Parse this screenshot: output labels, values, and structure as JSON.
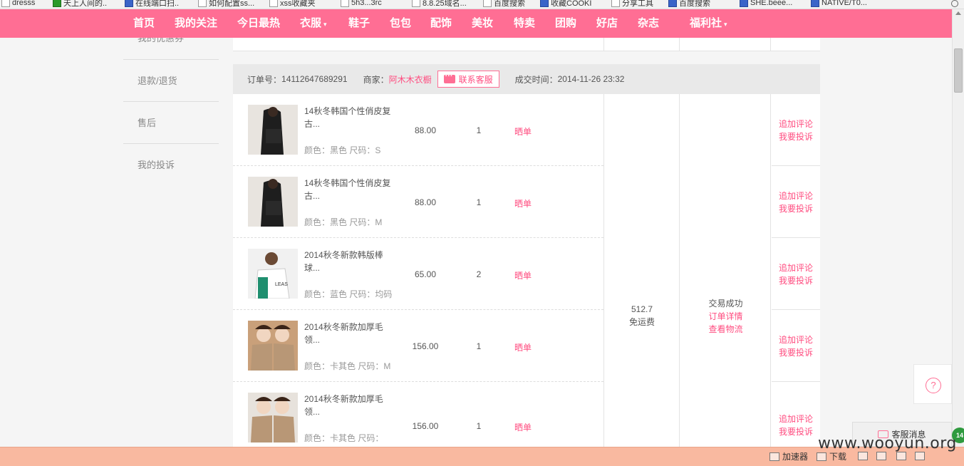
{
  "bookmarks": [
    {
      "label": "dresss",
      "icon": "page-icon"
    },
    {
      "label": "天上人间的..",
      "icon": "excel-icon"
    },
    {
      "label": "在线端口扫..",
      "icon": "tool-icon"
    },
    {
      "label": "如何配置ss...",
      "icon": "page-icon"
    },
    {
      "label": "xss收藏夹",
      "icon": "page-icon"
    },
    {
      "label": "5h3...3rc",
      "icon": "page-icon"
    },
    {
      "label": "8.8.25域名...",
      "icon": "page-icon"
    },
    {
      "label": "百度搜索",
      "icon": "page-icon"
    },
    {
      "label": "收藏COOKI",
      "icon": "globe-icon"
    },
    {
      "label": "分享工具",
      "icon": "page-icon"
    },
    {
      "label": "百度搜索",
      "icon": "page-icon"
    },
    {
      "label": "SHE.beee...",
      "icon": "page-icon"
    },
    {
      "label": "NATIVE/T0...",
      "icon": "page-icon"
    }
  ],
  "nav": {
    "items": [
      "首页",
      "我的关注",
      "今日最热",
      "衣服",
      "鞋子",
      "包包",
      "配饰",
      "美妆",
      "特卖",
      "团购",
      "好店",
      "杂志",
      "福利社"
    ],
    "dropdown_caret": "▾"
  },
  "sidebar": {
    "items": [
      "我的优惠券",
      "退款/退货",
      "售后",
      "我的投诉"
    ]
  },
  "order": {
    "number_label": "订单号：",
    "number": "14112647689291",
    "merchant_label": "商家：",
    "merchant": "阿木木衣橱",
    "contact_button": "联系客服",
    "time_label": "成交时间：",
    "time": "2014-11-26 23:32",
    "total": "512.7",
    "shipping": "免运费",
    "status": "交易成功",
    "detail_link": "订单详情",
    "logistics_link": "查看物流",
    "products": [
      {
        "name": "14秋冬韩国个性俏皮复古...",
        "attrs": "颜色：黑色 尺码：S",
        "price": "88.00",
        "qty": "1",
        "show": "晒单",
        "review": "追加评论",
        "complain": "我要投诉"
      },
      {
        "name": "14秋冬韩国个性俏皮复古...",
        "attrs": "颜色：黑色 尺码：M",
        "price": "88.00",
        "qty": "1",
        "show": "晒单",
        "review": "追加评论",
        "complain": "我要投诉"
      },
      {
        "name": "2014秋冬新款韩版棒球...",
        "attrs": "颜色：蓝色 尺码：均码",
        "price": "65.00",
        "qty": "2",
        "show": "晒单",
        "review": "追加评论",
        "complain": "我要投诉"
      },
      {
        "name": "2014秋冬新款加厚毛领...",
        "attrs": "颜色：卡其色 尺码：M",
        "price": "156.00",
        "qty": "1",
        "show": "晒单",
        "review": "追加评论",
        "complain": "我要投诉"
      },
      {
        "name": "2014秋冬新款加厚毛领...",
        "attrs": "颜色：卡其色 尺码：",
        "price": "156.00",
        "qty": "1",
        "show": "晒单",
        "review": "追加评论",
        "complain": "我要投诉"
      }
    ]
  },
  "help_button": "?",
  "cs_message": "客服消息",
  "cs_badge": "14",
  "statusbar": {
    "accelerator": "加速器",
    "download": "下载"
  },
  "watermark": "www.wooyun.org",
  "colors": {
    "brand_pink": "#ff6e94",
    "link_pink": "#ff4d80",
    "statusbar": "#f9b9a0"
  }
}
